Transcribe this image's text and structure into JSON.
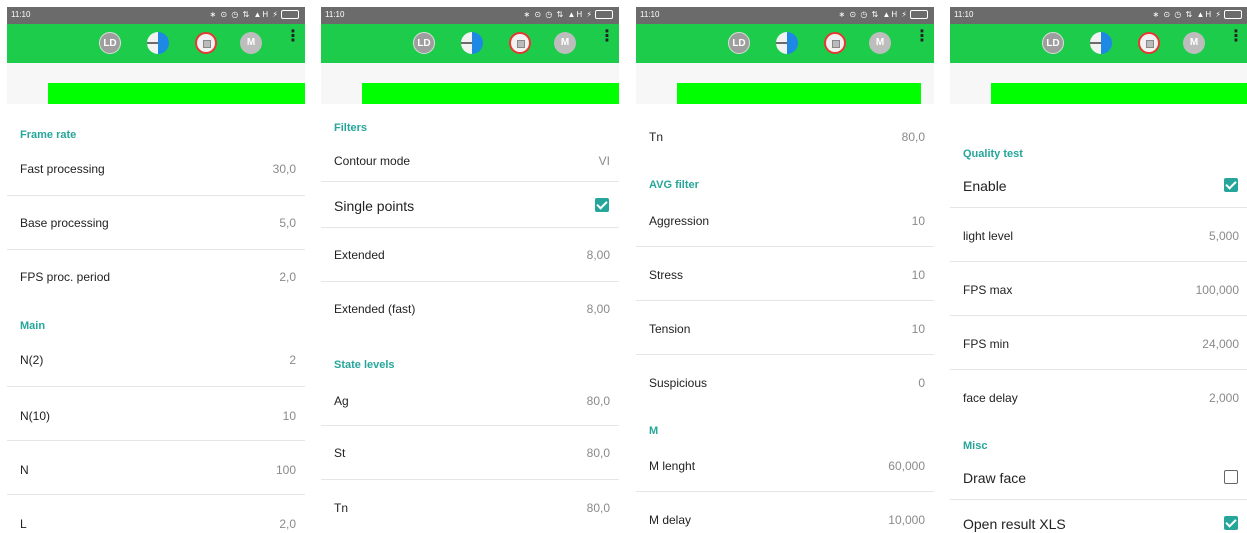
{
  "status_time": "11:10",
  "status_icons": "∗ ⊙ ◷ ⇅ ▲H ⚡",
  "appbar": {
    "ld_label": "LD",
    "m_label": "M",
    "more_label": "⋮"
  },
  "panels": [
    {
      "sections": [
        {
          "title": "Frame rate"
        },
        {
          "title": "Main"
        }
      ],
      "rows": [
        {
          "label": "Fast processing",
          "value": "30,0"
        },
        {
          "label": "Base processing",
          "value": "5,0"
        },
        {
          "label": "FPS proc. period",
          "value": "2,0"
        },
        {
          "label": "N(2)",
          "value": "2"
        },
        {
          "label": "N(10)",
          "value": "10"
        },
        {
          "label": "N",
          "value": "100"
        },
        {
          "label": "L",
          "value": "2,0"
        }
      ]
    },
    {
      "sections": [
        {
          "title": "Filters"
        },
        {
          "title": "State levels"
        }
      ],
      "rows": [
        {
          "label": "Contour mode",
          "value": "VI"
        },
        {
          "label": "Single points",
          "checked": true
        },
        {
          "label": "Extended",
          "value": "8,00"
        },
        {
          "label": "Extended (fast)",
          "value": "8,00"
        },
        {
          "label": "Ag",
          "value": "80,0"
        },
        {
          "label": "St",
          "value": "80,0"
        },
        {
          "label": "Tn",
          "value": "80,0"
        }
      ]
    },
    {
      "sections": [
        {
          "title": "AVG filter"
        },
        {
          "title": "M"
        }
      ],
      "rows": [
        {
          "label": "Tn",
          "value": "80,0"
        },
        {
          "label": "Aggression",
          "value": "10"
        },
        {
          "label": "Stress",
          "value": "10"
        },
        {
          "label": "Tension",
          "value": "10"
        },
        {
          "label": "Suspicious",
          "value": "0"
        },
        {
          "label": "M lenght",
          "value": "60,000"
        },
        {
          "label": "M delay",
          "value": "10,000"
        }
      ]
    },
    {
      "sections": [
        {
          "title": "Quality test"
        },
        {
          "title": "Misc"
        }
      ],
      "rows": [
        {
          "label": "Enable",
          "checked": true
        },
        {
          "label": "light level",
          "value": "5,000"
        },
        {
          "label": "FPS max",
          "value": "100,000"
        },
        {
          "label": "FPS min",
          "value": "24,000"
        },
        {
          "label": "face delay",
          "value": "2,000"
        },
        {
          "label": "Draw face",
          "checked": false
        },
        {
          "label": "Open result XLS",
          "checked": true
        }
      ]
    }
  ],
  "colors": {
    "appbar": "#1ccc4a",
    "greenbar": "#00ff00",
    "accent": "#26a69a",
    "statusbar": "#6b6b6b"
  }
}
